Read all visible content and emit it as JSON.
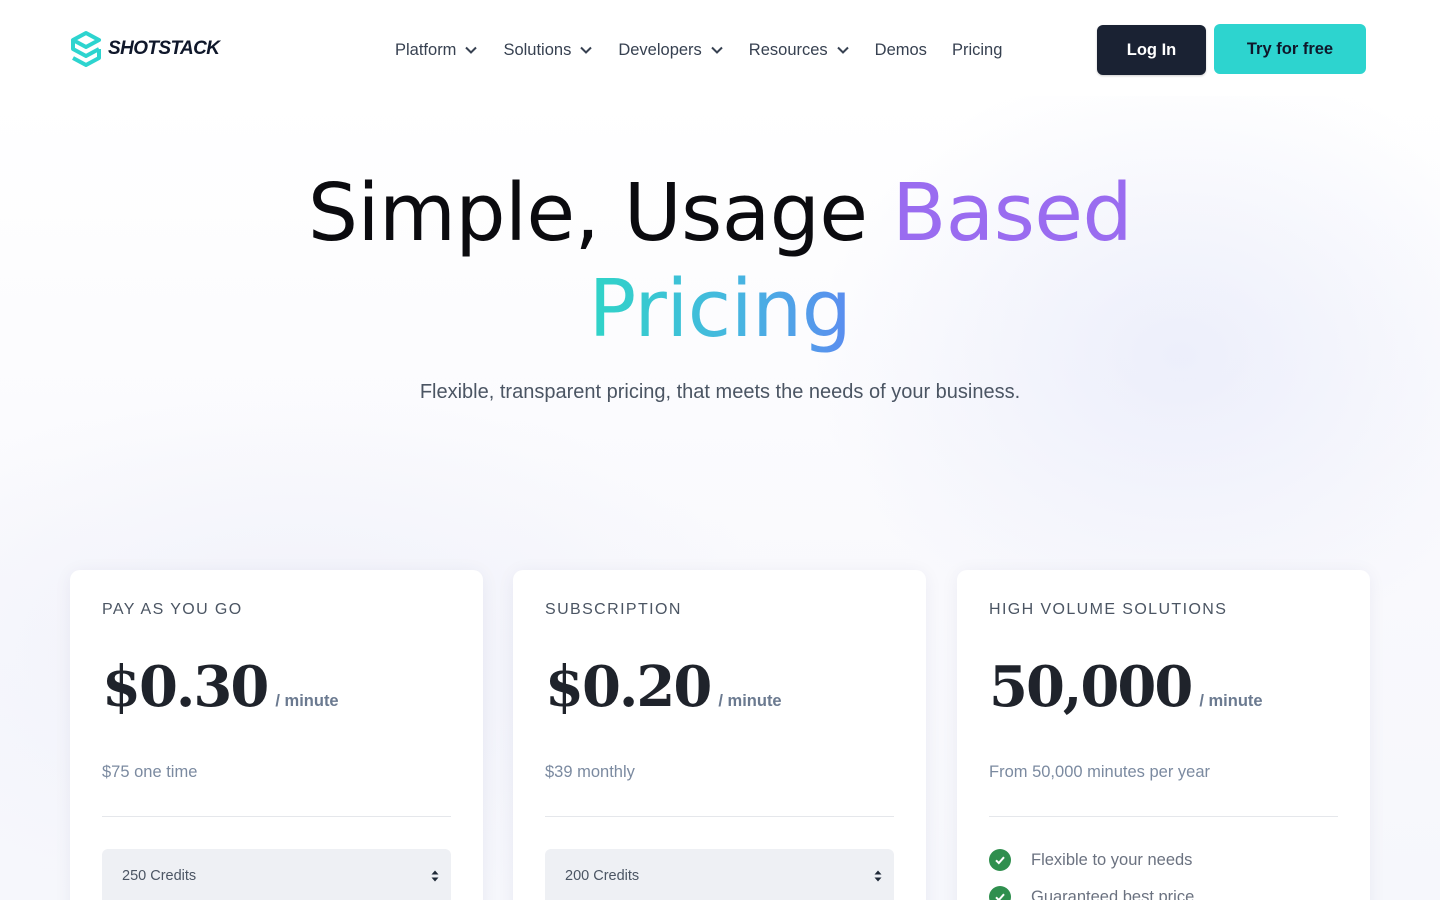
{
  "brand": {
    "name": "SHOTSTACK",
    "accent": "#2dd4cf",
    "dark": "#1a2233",
    "purple": "#9a6cf0"
  },
  "nav": {
    "items": [
      {
        "label": "Platform",
        "dropdown": true
      },
      {
        "label": "Solutions",
        "dropdown": true
      },
      {
        "label": "Developers",
        "dropdown": true
      },
      {
        "label": "Resources",
        "dropdown": true
      },
      {
        "label": "Demos",
        "dropdown": false
      },
      {
        "label": "Pricing",
        "dropdown": false
      }
    ],
    "login_label": "Log In",
    "try_label": "Try for free"
  },
  "hero": {
    "title_part1": "Simple, Usage ",
    "title_part2": "Based",
    "title_part3": "Pricing",
    "subtitle": "Flexible, transparent pricing, that meets the needs of your business."
  },
  "plans": [
    {
      "label": "PAY AS YOU GO",
      "price": "$0.30",
      "per": "/ minute",
      "note": "$75 one time",
      "select_value": "250 Credits"
    },
    {
      "label": "SUBSCRIPTION",
      "price": "$0.20",
      "per": "/ minute",
      "note": "$39 monthly",
      "select_value": "200 Credits"
    },
    {
      "label": "HIGH VOLUME SOLUTIONS",
      "price": "50,000",
      "per": "/ minute",
      "note": "From 50,000 minutes per year",
      "features": [
        "Flexible to your needs",
        "Guaranteed best price"
      ]
    }
  ]
}
